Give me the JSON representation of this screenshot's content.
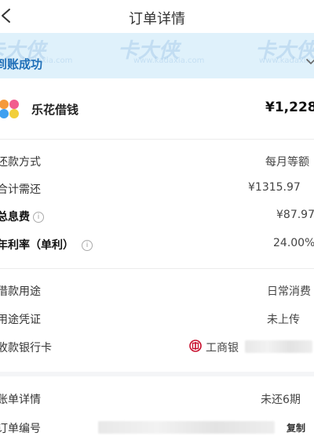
{
  "header": {
    "title": "订单详情"
  },
  "banner": {
    "status": "到账成功",
    "watermark": "卡大侠",
    "watermark_url": "www.kadaxia.com"
  },
  "product": {
    "name": "乐花借钱",
    "amount": "¥1,228"
  },
  "details": [
    {
      "label": "还款方式",
      "value": "每月等额"
    },
    {
      "label": "合计需还",
      "value": "¥1315.97"
    },
    {
      "label": "总息费",
      "value": "¥87.97"
    },
    {
      "label": "年利率（单利）",
      "value": "24.00%"
    }
  ],
  "usage": [
    {
      "label": "借款用途",
      "value": "日常消费"
    },
    {
      "label": "用途凭证",
      "value": "未上传"
    },
    {
      "label": "收款银行卡",
      "value": "工商银"
    }
  ],
  "bill": [
    {
      "label": "账单详情",
      "value": "未还6期"
    },
    {
      "label": "订单编号",
      "value": "复制"
    }
  ],
  "colors": {
    "banner_bg": "#dff1fb",
    "banner_text": "#1f6fb8"
  }
}
